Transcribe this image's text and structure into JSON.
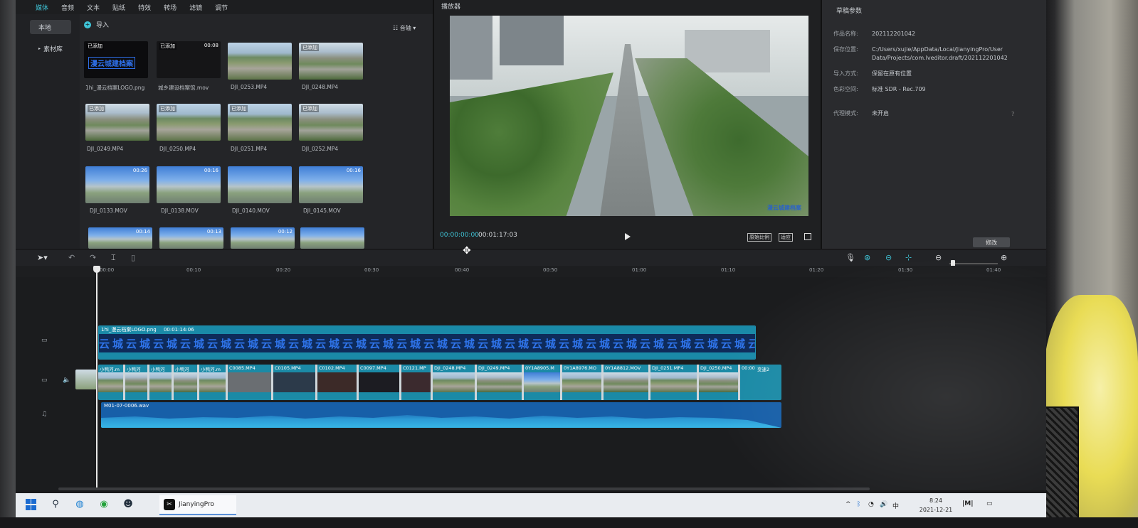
{
  "menu_tabs": [
    "媒体",
    "音频",
    "文本",
    "贴纸",
    "特效",
    "转场",
    "滤镜",
    "调节"
  ],
  "sidebar": [
    "本地",
    "素材库"
  ],
  "import_label": "导入",
  "sort_label": "音轴",
  "media_items": [
    {
      "name": "1hi_漫云档案LOGO.png",
      "tag": "已添加",
      "duration": ""
    },
    {
      "name": "城乡建设档案馆.mov",
      "tag": "已添加",
      "duration": "00:08"
    },
    {
      "name": "DJI_0253.MP4",
      "tag": "",
      "duration": ""
    },
    {
      "name": "DJI_0248.MP4",
      "tag": "已添加",
      "duration": ""
    },
    {
      "name": "DJI_0249.MP4",
      "tag": "已添加",
      "duration": ""
    },
    {
      "name": "DJI_0250.MP4",
      "tag": "已添加",
      "duration": ""
    },
    {
      "name": "DJI_0251.MP4",
      "tag": "已添加",
      "duration": ""
    },
    {
      "name": "DJI_0252.MP4",
      "tag": "已添加",
      "duration": ""
    },
    {
      "name": "DJI_0133.MOV",
      "tag": "",
      "duration": "00:26"
    },
    {
      "name": "DJI_0138.MOV",
      "tag": "",
      "duration": "00:16"
    },
    {
      "name": "DJI_0140.MOV",
      "tag": "",
      "duration": ""
    },
    {
      "name": "DJI_0145.MOV",
      "tag": "",
      "duration": "00:16"
    },
    {
      "name": "",
      "tag": "",
      "duration": "00:14"
    },
    {
      "name": "",
      "tag": "",
      "duration": "00:13"
    },
    {
      "name": "",
      "tag": "",
      "duration": "00:12"
    },
    {
      "name": "",
      "tag": "",
      "duration": ""
    }
  ],
  "logo_thumb_text": "漫云城建档案",
  "player": {
    "title": "播放器",
    "current": "00:00:00:00",
    "total": "00:01:17:03",
    "ratio_a": "原始比例",
    "ratio_b": "适应",
    "watermark": "漫云城建档案"
  },
  "params": {
    "title": "草稿参数",
    "rows": [
      {
        "label": "作品名称:",
        "value": "202112201042"
      },
      {
        "label": "保存位置:",
        "value": "C:/Users/xujie/AppData/Local/JianyingPro/User Data/Projects/com.lveditor.draft/202112201042"
      },
      {
        "label": "导入方式:",
        "value": "保留在原有位置"
      },
      {
        "label": "色彩空间:",
        "value": "标准 SDR - Rec.709"
      },
      {
        "label": "代理模式:",
        "value": "未开启"
      }
    ],
    "edit_label": "修改"
  },
  "ruler": [
    "00:00",
    "00:10",
    "00:20",
    "00:30",
    "00:40",
    "00:50",
    "01:00",
    "01:10",
    "01:20",
    "01:30",
    "01:40"
  ],
  "logo_clip": {
    "name": "1hi_漫云档案LOGO.png",
    "duration": "00:01:14:06",
    "strip": "云城云城云城云城云城云城云城云城云城云城云城云城云城云城云城云城云城云城云城云城云城云城云城云城云城云城云城云城云城"
  },
  "video_clips": [
    "小鸭河.m",
    "小鸭河",
    "小鸭河",
    "小鸭河",
    "小鸭河.m",
    "C0085.MP4",
    "C0105.MP4",
    "C0102.MP4",
    "C0097.MP4",
    "C0121.MP",
    "DJI_0248.MP4",
    "DJI_0249.MP4",
    "0Y1A8905.M",
    "0Y1A8976.MO",
    "0Y1A8812.MOV",
    "DJI_0251.MP4",
    "DJI_0250.MP4",
    "00:00",
    "变速2"
  ],
  "audio_clip": "M01-07-0006.wav",
  "taskbar": {
    "app": "JianyingPro",
    "time": "8:24",
    "date": "2021-12-21"
  },
  "colors": {
    "accent": "#3fc5d8",
    "logo_blue": "#2f74ea"
  }
}
